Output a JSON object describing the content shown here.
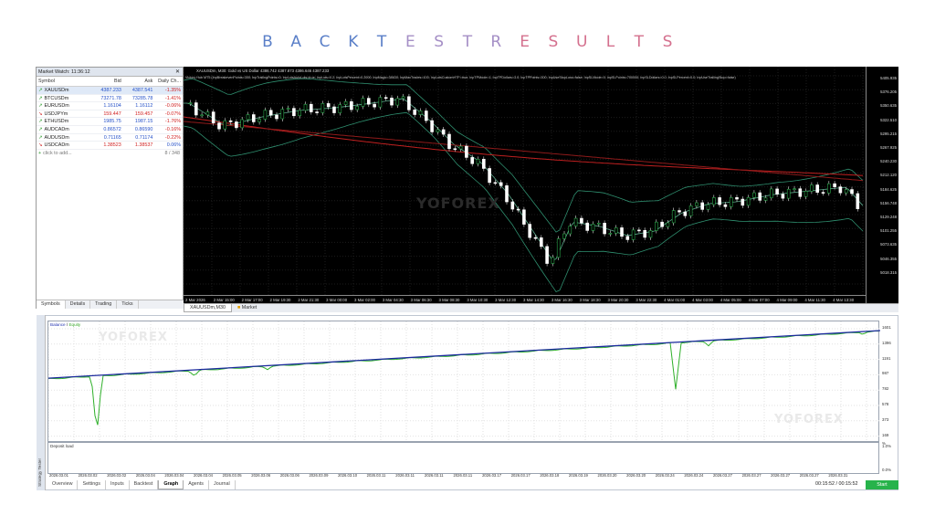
{
  "banner": {
    "letters": [
      "B",
      "A",
      "C",
      "K",
      "T",
      "E",
      "S",
      "T",
      "R",
      "E",
      "S",
      "U",
      "L",
      "T",
      "S"
    ]
  },
  "market_watch": {
    "title": "Market Watch: 11:36:12",
    "columns": {
      "symbol": "Symbol",
      "bid": "Bid",
      "ask": "Ask",
      "change": "Daily Ch..."
    },
    "rows": [
      {
        "symbol": "XAUUSDm",
        "bid": "4387.233",
        "ask": "4387.541",
        "change": "-1.35%",
        "dir": "up"
      },
      {
        "symbol": "BTCUSDm",
        "bid": "73271.78",
        "ask": "73285.78",
        "change": "-1.41%",
        "dir": "up"
      },
      {
        "symbol": "EURUSDm",
        "bid": "1.16104",
        "ask": "1.16112",
        "change": "-0.06%",
        "dir": "up"
      },
      {
        "symbol": "USDJPYm",
        "bid": "159.447",
        "ask": "159.457",
        "change": "-0.07%",
        "dir": "down"
      },
      {
        "symbol": "ETHUSDm",
        "bid": "1985.75",
        "ask": "1987.15",
        "change": "-1.76%",
        "dir": "up"
      },
      {
        "symbol": "AUDCADm",
        "bid": "0.86572",
        "ask": "0.86590",
        "change": "-0.16%",
        "dir": "up"
      },
      {
        "symbol": "AUDUSDm",
        "bid": "0.71165",
        "ask": "0.71174",
        "change": "-0.22%",
        "dir": "up"
      },
      {
        "symbol": "USDCADm",
        "bid": "1.38523",
        "ask": "1.38537",
        "change": "0.06%",
        "dir": "down"
      }
    ],
    "add_label": "click to add...",
    "count": "8 / 348",
    "tabs": [
      "Symbols",
      "Details",
      "Trading",
      "Ticks"
    ],
    "active_tab": "Symbols"
  },
  "price_chart": {
    "header": "XAUUSDm, M30: Gold vs US Dollar 4386.742 4387.873 4386.646 4387.233",
    "params": "Victory Hub MT5 (InpBreakevenPoints=300; InpTrailingPoints=0; InpLotsAutoLots=true; InpLots=0.2; InpLotsPercent=0.2000; InpMagic=38630; InpMaxTrades=100; InpLotsCustomHTF=true; InpTPMode=1; InpTPDollars=3.0; InpTPPoints=300; InpUseStopLoss=false; InpSLMode=0; InpSLPoints=700000; InpSLDollars=0.0; InpSLPercent=0.0; InpUseTrailingStop=false)",
    "price_labels": [
      "5405.935",
      "5376.205",
      "5350.635",
      "5322.510",
      "5295.215",
      "5267.925",
      "5240.230",
      "5212.120",
      "5184.625",
      "5156.748",
      "5129.248",
      "5101.255",
      "5073.635",
      "5046.355",
      "5018.315"
    ],
    "time_labels": [
      "2 Mar 2026",
      "2 Mar 15:00",
      "2 Mar 17:00",
      "2 Mar 19:30",
      "2 Mar 21:30",
      "3 Mar 00:00",
      "3 Mar 02:00",
      "3 Mar 04:30",
      "3 Mar 06:30",
      "3 Mar 08:30",
      "3 Mar 10:30",
      "3 Mar 12:30",
      "3 Mar 14:30",
      "3 Mar 16:30",
      "3 Mar 18:30",
      "3 Mar 20:30",
      "3 Mar 22:30",
      "4 Mar 01:00",
      "4 Mar 03:00",
      "4 Mar 05:00",
      "4 Mar 07:00",
      "4 Mar 09:00",
      "4 Mar 11:30",
      "4 Mar 13:30"
    ],
    "tabs": [
      "XAUUSDm,M30",
      "Market"
    ],
    "active_tab": "XAUUSDm,M30",
    "watermark": "YOFOREX"
  },
  "tester": {
    "side_label": "Strategy Tester",
    "legend_balance": "Balance",
    "legend_sep": " / ",
    "legend_equity": "Equity",
    "balance_labels": [
      "1601",
      "1396",
      "1191",
      "987",
      "782",
      "578",
      "373",
      "169"
    ],
    "deposit_label": "Deposit load",
    "deposit_labels": [
      "1.0%",
      "0.0%"
    ],
    "deposit_unit": "%",
    "date_labels": [
      "2026.03.01",
      "2026.03.02",
      "2026.03.02",
      "2026.03.04",
      "2026.03.04",
      "2026.03.04",
      "2026.03.05",
      "2026.03.06",
      "2026.03.06",
      "2026.03.09",
      "2026.03.10",
      "2026.03.11",
      "2026.03.11",
      "2026.03.11",
      "2026.03.11",
      "2026.03.17",
      "2026.03.17",
      "2026.03.18",
      "2026.03.19",
      "2026.03.20",
      "2026.03.20",
      "2026.03.24",
      "2026.03.24",
      "2026.03.27",
      "2026.03.27",
      "2026.03.27",
      "2026.03.27",
      "2026.03.31"
    ],
    "tabs": [
      "Overview",
      "Settings",
      "Inputs",
      "Backtest",
      "Graph",
      "Agents",
      "Journal"
    ],
    "active_tab": "Graph",
    "timer": "00:15:52 / 00:15:52",
    "start_label": "Start",
    "watermark": "YOFOREX",
    "colors": {
      "balance": "#1c2a9e",
      "equity": "#2fb02a"
    }
  },
  "chart_data": {
    "type": "line",
    "title": "",
    "series": [
      {
        "name": "Balance",
        "values": [
          940,
          1601
        ]
      },
      {
        "name": "Equity",
        "values": [
          940,
          910,
          150,
          930,
          880,
          1000,
          1060,
          1150,
          1250,
          1350,
          1440,
          750,
          1480,
          1500,
          1601
        ]
      }
    ],
    "ylim": [
      169,
      1601
    ]
  }
}
